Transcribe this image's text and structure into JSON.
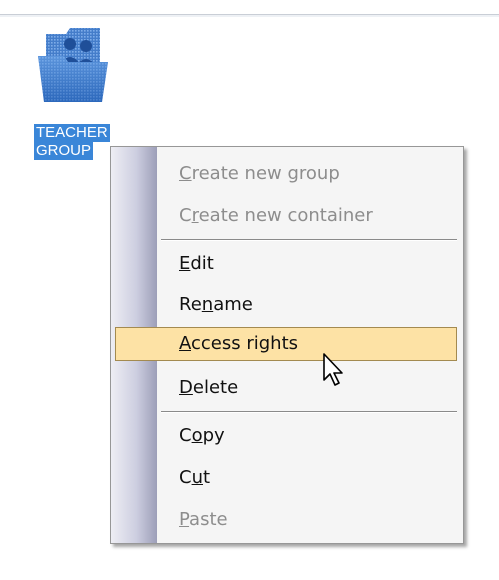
{
  "desktop": {
    "folder": {
      "icon": "folder-group-icon",
      "label_line1": "TEACHER",
      "label_line2": "GROUP"
    }
  },
  "context_menu": {
    "items": [
      {
        "pre": "",
        "ul": "C",
        "post": "reate new group",
        "enabled": false
      },
      {
        "pre": "C",
        "ul": "r",
        "post": "eate new container",
        "enabled": false
      },
      {
        "pre": "",
        "ul": "E",
        "post": "dit",
        "enabled": true
      },
      {
        "pre": "Re",
        "ul": "n",
        "post": "ame",
        "enabled": true
      },
      {
        "pre": "",
        "ul": "A",
        "post": "ccess rights",
        "enabled": true,
        "highlighted": true
      },
      {
        "pre": "",
        "ul": "D",
        "post": "elete",
        "enabled": true
      },
      {
        "pre": "C",
        "ul": "o",
        "post": "py",
        "enabled": true
      },
      {
        "pre": "C",
        "ul": "u",
        "post": "t",
        "enabled": true
      },
      {
        "pre": "",
        "ul": "P",
        "post": "aste",
        "enabled": false
      }
    ]
  },
  "colors": {
    "selection": "#3a86d8",
    "menu_highlight": "#fde2a5",
    "menu_highlight_border": "#a38a50",
    "disabled_text": "#8d8d8d"
  },
  "cursor": "arrow-pointer-icon"
}
